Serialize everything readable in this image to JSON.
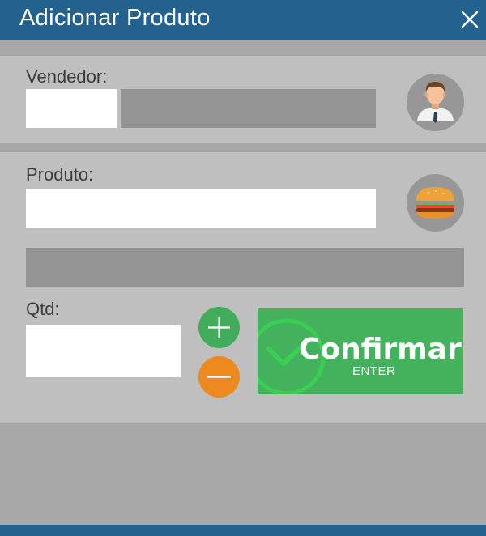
{
  "window": {
    "title": "Adicionar Produto"
  },
  "vendor": {
    "label": "Vendedor:",
    "code_value": "",
    "name_value": ""
  },
  "product": {
    "label": "Produto:",
    "search_value": "",
    "description_value": ""
  },
  "quantity": {
    "label": "Qtd:",
    "value": ""
  },
  "confirm": {
    "label": "Confirmar",
    "shortcut": "ENTER"
  },
  "icons": {
    "close": "close-icon",
    "vendor": "salesman-avatar-icon",
    "product": "burger-icon",
    "increment": "plus-icon",
    "decrement": "minus-icon",
    "confirm": "checkmark-icon"
  },
  "colors": {
    "titlebar": "#23618f",
    "confirm": "#44b25c",
    "increment": "#41ad5c",
    "decrement": "#ec8a1f"
  }
}
